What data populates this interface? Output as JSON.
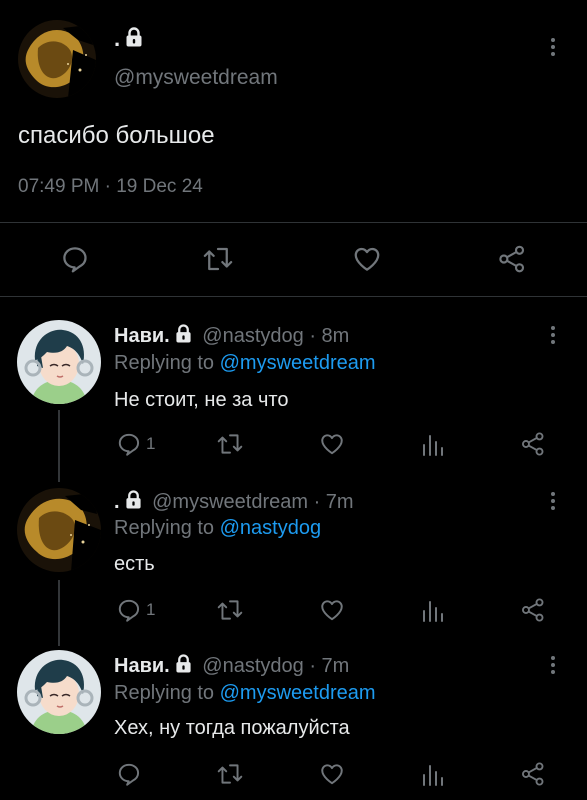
{
  "main_tweet": {
    "display_name": ".",
    "handle": "@mysweetdream",
    "text": "спасибо большое",
    "timestamp": "07:49 PM · 19 Dec 24"
  },
  "replies": [
    {
      "display_name": "Нави.",
      "handle": "@nastydog",
      "time": "· 8m",
      "replying_prefix": "Replying to",
      "replying_to": "@mysweetdream",
      "text": "Не стоит, не за что",
      "reply_count": "1"
    },
    {
      "display_name": ".",
      "handle": "@mysweetdream",
      "time": "· 7m",
      "replying_prefix": "Replying to",
      "replying_to": "@nastydog",
      "text": "есть",
      "reply_count": "1"
    },
    {
      "display_name": "Нави.",
      "handle": "@nastydog",
      "time": "· 7m",
      "replying_prefix": "Replying to",
      "replying_to": "@mysweetdream",
      "text": "Хех, ну тогда пожалуйста",
      "reply_count": ""
    }
  ],
  "colors": {
    "background": "#000000",
    "text": "#e7e9ea",
    "muted": "#71767b",
    "link": "#1d9bf0"
  },
  "icons": [
    "reply-icon",
    "retweet-icon",
    "like-icon",
    "analytics-icon",
    "share-icon",
    "lock-icon",
    "more-icon"
  ]
}
